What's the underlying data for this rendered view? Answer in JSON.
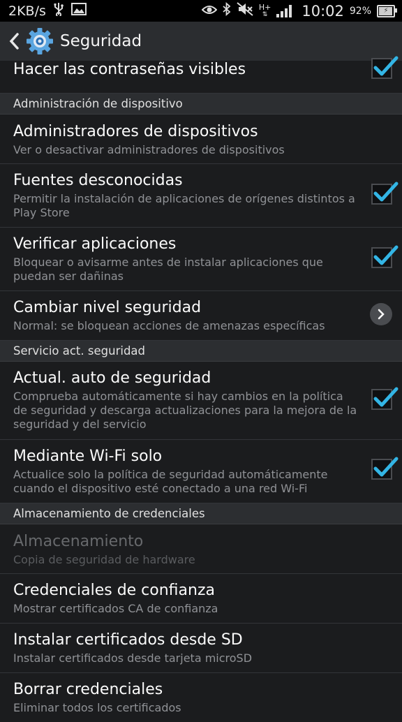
{
  "status_bar": {
    "speed": "2KB/s",
    "network_type": "H+",
    "time": "10:02",
    "battery": "92%",
    "icons": [
      "usb-icon",
      "image-icon",
      "eye-icon",
      "bluetooth-icon",
      "mute-icon",
      "signal-icon",
      "battery-icon"
    ]
  },
  "action_bar": {
    "title": "Seguridad",
    "icons": [
      "back-icon",
      "gear-icon"
    ]
  },
  "list": {
    "visible_passwords": {
      "title": "Hacer las contraseñas visibles",
      "checked": true
    },
    "section_admin": "Administración de dispositivo",
    "device_admins": {
      "title": "Administradores de dispositivos",
      "summary": "Ver o desactivar administradores de dispositivos"
    },
    "unknown_sources": {
      "title": "Fuentes desconocidas",
      "summary": "Permitir la instalación de aplicaciones de orígenes distintos a Play Store",
      "checked": true
    },
    "verify_apps": {
      "title": "Verificar aplicaciones",
      "summary": "Bloquear o avisarme antes de instalar aplicaciones que puedan ser dañinas",
      "checked": true
    },
    "security_level": {
      "title": "Cambiar nivel seguridad",
      "summary": "Normal: se bloquean acciones de amenazas específicas"
    },
    "section_service": "Servicio act. seguridad",
    "auto_update": {
      "title": "Actual. auto de seguridad",
      "summary": "Comprueba automáticamente si hay cambios en la política de seguridad y descarga actualizaciones para la mejora de la seguridad y del servicio",
      "checked": true
    },
    "wifi_only": {
      "title": "Mediante Wi-Fi solo",
      "summary": "Actualice solo la política de seguridad automáticamente cuando el dispositivo esté conectado a una red Wi-Fi",
      "checked": true
    },
    "section_credentials": "Almacenamiento de credenciales",
    "storage": {
      "title": "Almacenamiento",
      "summary": "Copia de seguridad de hardware",
      "enabled": false
    },
    "trusted_credentials": {
      "title": "Credenciales de confianza",
      "summary": "Mostrar certificados CA de confianza"
    },
    "install_from_sd": {
      "title": "Instalar certificados desde SD",
      "summary": "Instalar certificados desde tarjeta microSD"
    },
    "clear_credentials": {
      "title": "Borrar credenciales",
      "summary": "Eliminar todos los certificados"
    }
  },
  "colors": {
    "accent": "#33b5e5",
    "background": "#1b1c1e",
    "section": "#2c2e31",
    "summary_text": "#909296"
  }
}
